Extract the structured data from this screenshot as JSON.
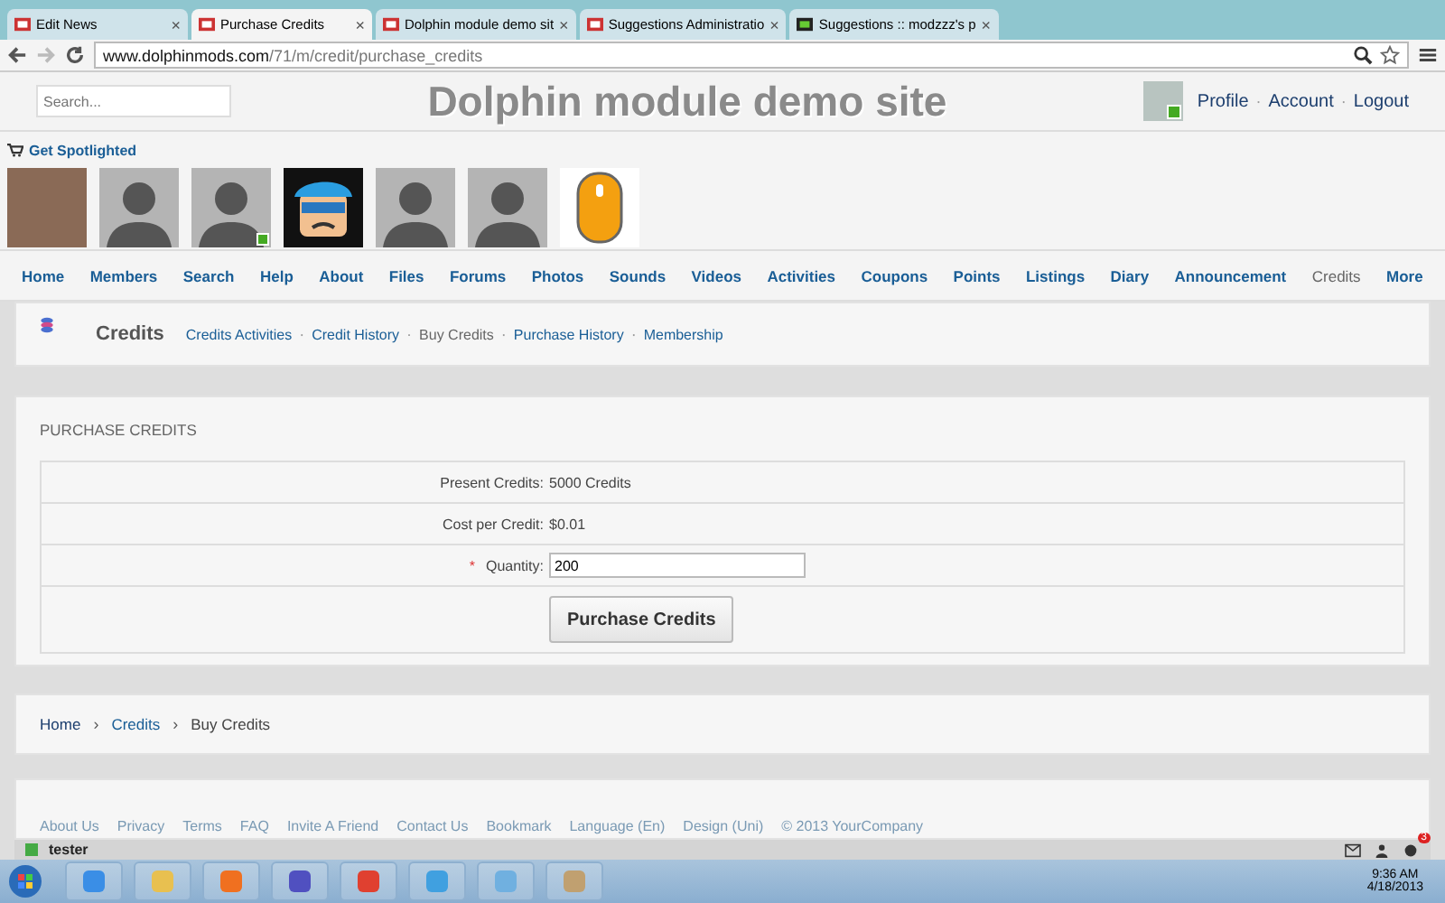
{
  "browser": {
    "tabs": [
      {
        "title": "Edit News",
        "selected": false
      },
      {
        "title": "Purchase Credits",
        "selected": true
      },
      {
        "title": "Dolphin module demo sit",
        "selected": false
      },
      {
        "title": "Suggestions Administratio",
        "selected": false
      },
      {
        "title": "Suggestions :: modzzz's p",
        "selected": false
      }
    ],
    "tab_close": "×",
    "url": {
      "domain": "www.dolphinmods.com",
      "path": "/71/m/credit/purchase_credits"
    }
  },
  "header": {
    "search": {
      "placeholder": "Search..."
    },
    "site_title": "Dolphin module demo site",
    "user_online": true,
    "user_links": [
      "Profile",
      "Account",
      "Logout"
    ]
  },
  "spotlight": {
    "label": "Get Spotlighted",
    "members": [
      {
        "kind": "photo",
        "online": false
      },
      {
        "kind": "silhouette",
        "online": false
      },
      {
        "kind": "silhouette",
        "online": true
      },
      {
        "kind": "cartoon",
        "online": false
      },
      {
        "kind": "silhouette",
        "online": false
      },
      {
        "kind": "silhouette",
        "online": false
      },
      {
        "kind": "mouse",
        "online": false
      }
    ]
  },
  "nav": [
    {
      "label": "Home",
      "selected": false
    },
    {
      "label": "Members",
      "selected": false
    },
    {
      "label": "Search",
      "selected": false
    },
    {
      "label": "Help",
      "selected": false
    },
    {
      "label": "About",
      "selected": false
    },
    {
      "label": "Files",
      "selected": false
    },
    {
      "label": "Forums",
      "selected": false
    },
    {
      "label": "Photos",
      "selected": false
    },
    {
      "label": "Sounds",
      "selected": false
    },
    {
      "label": "Videos",
      "selected": false
    },
    {
      "label": "Activities",
      "selected": false
    },
    {
      "label": "Coupons",
      "selected": false
    },
    {
      "label": "Points",
      "selected": false
    },
    {
      "label": "Listings",
      "selected": false
    },
    {
      "label": "Diary",
      "selected": false
    },
    {
      "label": "Announcement",
      "selected": false
    },
    {
      "label": "Credits",
      "selected": true
    },
    {
      "label": "More",
      "selected": false
    }
  ],
  "submenu": {
    "title": "Credits",
    "links": [
      {
        "label": "Credits Activities",
        "selected": false
      },
      {
        "label": "Credit History",
        "selected": false
      },
      {
        "label": "Buy Credits",
        "selected": true
      },
      {
        "label": "Purchase History",
        "selected": false
      },
      {
        "label": "Membership",
        "selected": false
      }
    ]
  },
  "form": {
    "heading": "PURCHASE CREDITS",
    "rows": [
      {
        "kind": "info",
        "label": "Present Credits:",
        "value": "5000 Credits"
      },
      {
        "kind": "info",
        "label": "Cost per Credit:",
        "value": "$0.01"
      },
      {
        "kind": "input",
        "label": "Quantity:",
        "value": "200",
        "required": true
      }
    ],
    "button": "Purchase Credits"
  },
  "breadcrumb": [
    {
      "label": "Home",
      "current": false
    },
    {
      "label": "Credits",
      "current": false
    },
    {
      "label": "Buy Credits",
      "current": true
    }
  ],
  "required_mark": "*",
  "breadcrumb_separator": "›",
  "link_separator": "·",
  "footer": {
    "links": [
      "About Us",
      "Privacy",
      "Terms",
      "FAQ",
      "Invite A Friend",
      "Contact Us",
      "Bookmark",
      "Language (En)",
      "Design (Uni)"
    ],
    "copyright": "© 2013 YourCompany"
  },
  "toolbar": {
    "user": "tester",
    "badge": "3"
  },
  "taskbar": {
    "time": "9:36 AM",
    "date": "4/18/2013"
  }
}
